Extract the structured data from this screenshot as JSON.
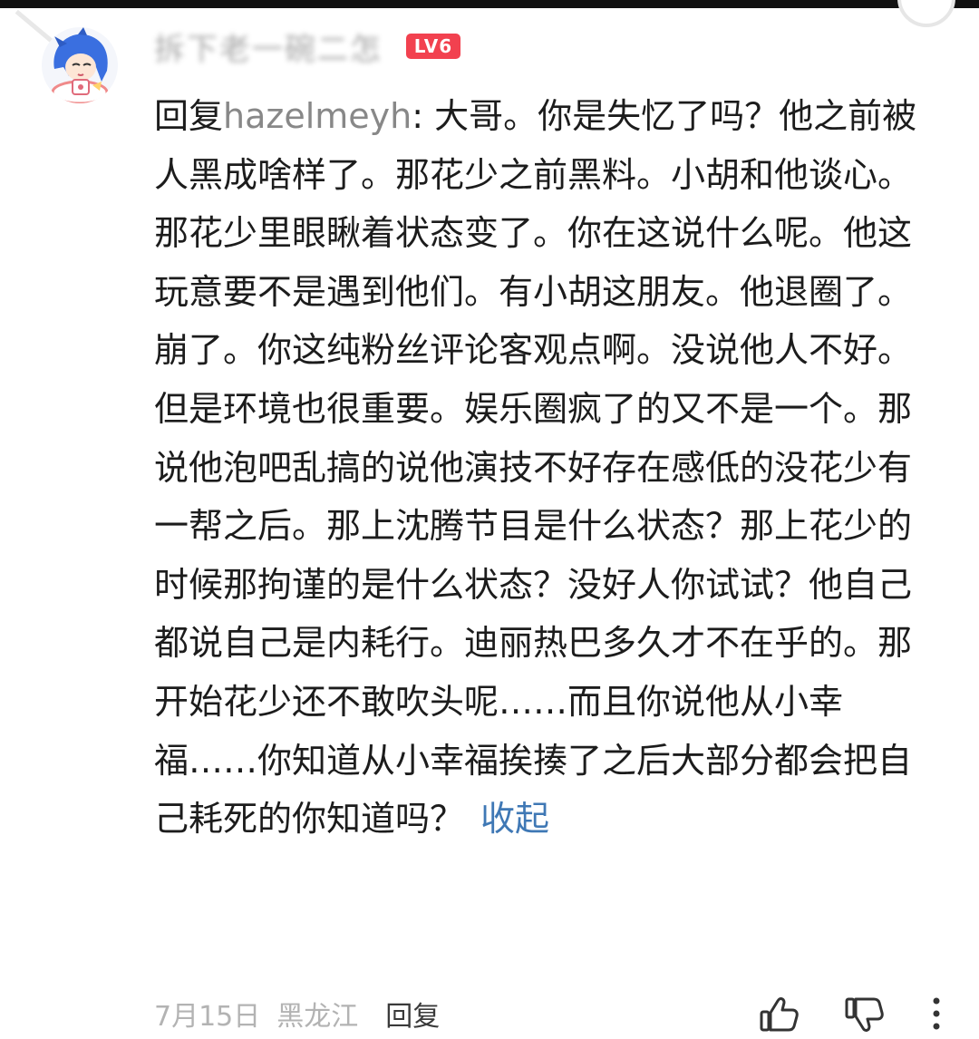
{
  "user": {
    "name": "拆下老一碗二怎",
    "level": "LV6"
  },
  "comment": {
    "reply_prefix": "回复",
    "reply_to": "hazelmeyh",
    "separator": ": ",
    "text": "大哥。你是失忆了吗？他之前被人黑成啥样了。那花少之前黑料。小胡和他谈心。那花少里眼瞅着状态变了。你在这说什么呢。他这玩意要不是遇到他们。有小胡这朋友。他退圈了。崩了。你这纯粉丝评论客观点啊。没说他人不好。但是环境也很重要。娱乐圈疯了的又不是一个。那说他泡吧乱搞的说他演技不好存在感低的没花少有一帮之后。那上沈腾节目是什么状态？那上花少的时候那拘谨的是什么状态？没好人你试试？他自己都说自己是内耗行。迪丽热巴多久才不在乎的。那开始花少还不敢吹头呢……而且你说他从小幸福……你知道从小幸福挨揍了之后大部分都会把自己耗死的你知道吗？",
    "collapse_label": "收起"
  },
  "footer": {
    "date": "7月15日",
    "location": "黑龙江",
    "reply_label": "回复"
  },
  "icons": {
    "like": "thumbs-up-icon",
    "dislike": "thumbs-down-icon",
    "more": "more-vertical-icon"
  },
  "colors": {
    "level_badge": "#f2414f",
    "link": "#3f78b5",
    "meta_text": "#b3b3b3"
  }
}
